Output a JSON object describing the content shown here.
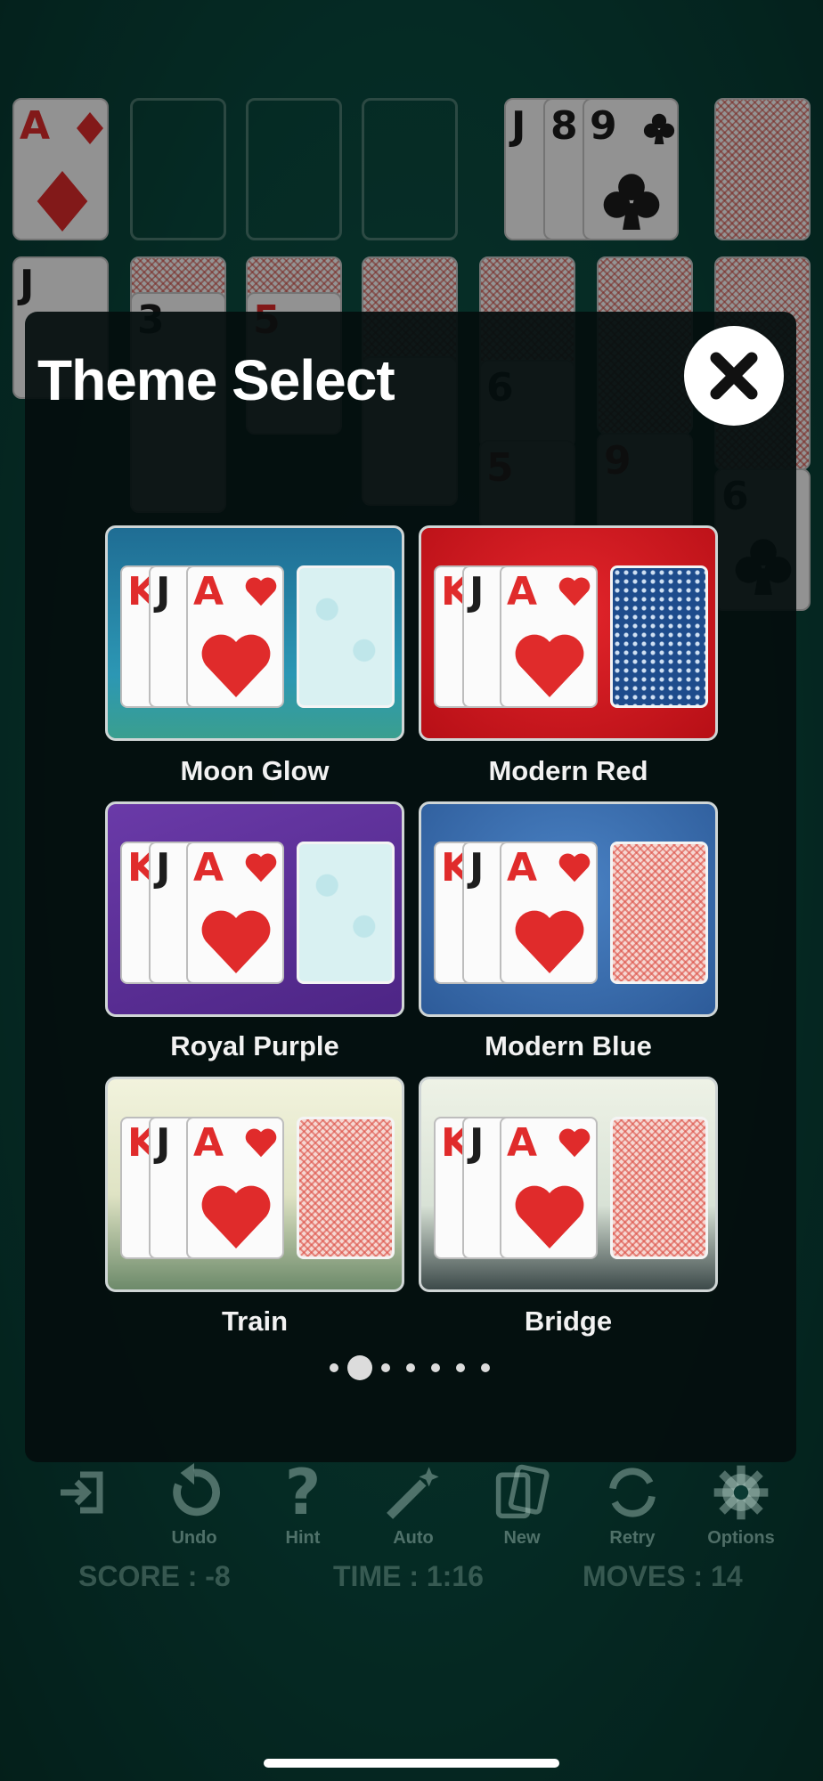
{
  "colors": {
    "accent_red": "#e02b2b",
    "panel_bg": "#040e0e",
    "felt": "#0a4a3f"
  },
  "board": {
    "foundation": [
      {
        "rank": "A",
        "suit": "diamond"
      }
    ],
    "waste": [
      {
        "rank": "J",
        "suit": "spade"
      },
      {
        "rank": "8",
        "suit": "spade"
      },
      {
        "rank": "9",
        "suit": "club"
      }
    ],
    "tableau_visible": [
      {
        "rank": "J",
        "suit": "club"
      },
      {
        "rank": "3",
        "suit": "spade"
      },
      {
        "rank": "5",
        "suit": "heart"
      },
      {
        "rank": "6",
        "suit": "spade"
      },
      {
        "rank": "5",
        "suit": "diamond"
      },
      {
        "rank": "9",
        "suit": "heart"
      },
      {
        "rank": "6",
        "suit": "club"
      }
    ]
  },
  "dialog": {
    "title": "Theme Select",
    "close_icon": "close-icon",
    "themes": [
      {
        "label": "Moon Glow",
        "bg": "#2a88a8",
        "back": "light-blue"
      },
      {
        "label": "Modern Red",
        "bg": "#c8141b",
        "back": "blue-dots"
      },
      {
        "label": "Royal Purple",
        "bg": "#5a2f95",
        "back": "light-blue"
      },
      {
        "label": "Modern Blue",
        "bg": "#3567a8",
        "back": "red-pattern"
      },
      {
        "label": "Train",
        "bg": "#e6ead2",
        "back": "red-pattern"
      },
      {
        "label": "Bridge",
        "bg": "#dde6df",
        "back": "red-pattern"
      }
    ],
    "preview_ranks": [
      "K",
      "J",
      "A"
    ],
    "pager": {
      "pages": 7,
      "current": 2
    }
  },
  "toolbar": {
    "items": [
      {
        "label": "",
        "icon": "exit-icon"
      },
      {
        "label": "Undo",
        "icon": "undo-icon"
      },
      {
        "label": "Hint",
        "icon": "hint-icon"
      },
      {
        "label": "Auto",
        "icon": "auto-icon"
      },
      {
        "label": "New",
        "icon": "new-game-icon"
      },
      {
        "label": "Retry",
        "icon": "retry-icon"
      },
      {
        "label": "Options",
        "icon": "gear-icon"
      }
    ]
  },
  "status": {
    "score": "SCORE :  -8",
    "time": "TIME :  1:16",
    "moves": "MOVES :  14"
  }
}
